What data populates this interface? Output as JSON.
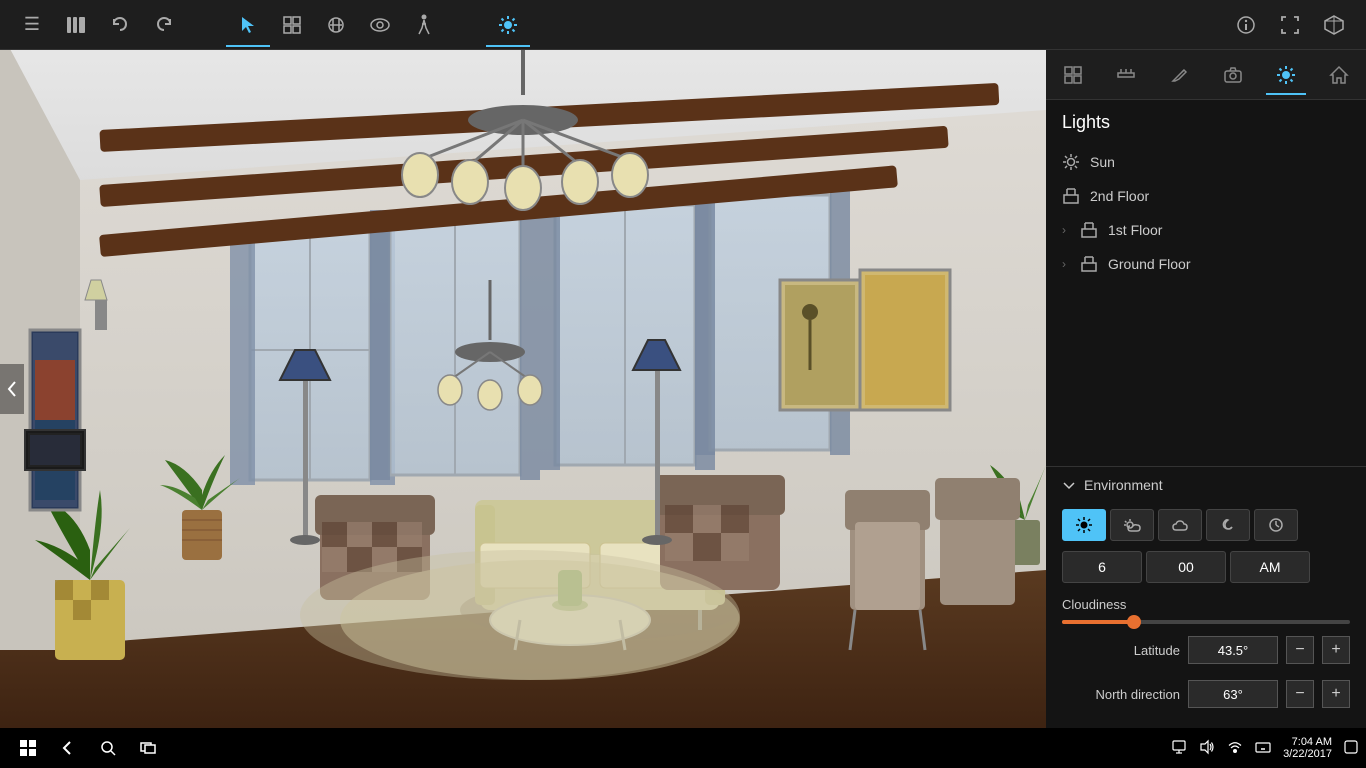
{
  "toolbar": {
    "icons": [
      {
        "name": "menu-icon",
        "symbol": "☰",
        "active": false
      },
      {
        "name": "library-icon",
        "symbol": "📚",
        "active": false
      },
      {
        "name": "undo-icon",
        "symbol": "↩",
        "active": false
      },
      {
        "name": "redo-icon",
        "symbol": "↪",
        "active": false
      },
      {
        "name": "select-icon",
        "symbol": "⬆",
        "active": true
      },
      {
        "name": "transform-icon",
        "symbol": "⊞",
        "active": false
      },
      {
        "name": "edit-icon",
        "symbol": "✂",
        "active": false
      },
      {
        "name": "view-icon",
        "symbol": "👁",
        "active": false
      },
      {
        "name": "walk-icon",
        "symbol": "🚶",
        "active": false
      },
      {
        "name": "sun-icon",
        "symbol": "☀",
        "active": true
      },
      {
        "name": "info-icon",
        "symbol": "ℹ",
        "active": false
      },
      {
        "name": "fullscreen-icon",
        "symbol": "⛶",
        "active": false
      },
      {
        "name": "cube-icon",
        "symbol": "⬡",
        "active": false
      }
    ]
  },
  "right_panel": {
    "tools": [
      {
        "name": "arrange-tool",
        "symbol": "🔧",
        "active": false
      },
      {
        "name": "measure-tool",
        "symbol": "📐",
        "active": false
      },
      {
        "name": "draw-tool",
        "symbol": "✏",
        "active": false
      },
      {
        "name": "camera-tool",
        "symbol": "📷",
        "active": false
      },
      {
        "name": "light-tool",
        "symbol": "☀",
        "active": true
      },
      {
        "name": "home-tool",
        "symbol": "🏠",
        "active": false
      }
    ],
    "lights_title": "Lights",
    "lights_items": [
      {
        "label": "Sun",
        "icon": "sun",
        "indent": false
      },
      {
        "label": "2nd Floor",
        "icon": "floor",
        "indent": false
      },
      {
        "label": "1st Floor",
        "icon": "floor",
        "indent": false,
        "chevron": true
      },
      {
        "label": "Ground Floor",
        "icon": "floor",
        "indent": false,
        "chevron": true
      }
    ],
    "environment": {
      "title": "Environment",
      "time_buttons": [
        {
          "label": "☀",
          "active": true
        },
        {
          "label": "⛅",
          "active": false
        },
        {
          "label": "☁",
          "active": false
        },
        {
          "label": "🌙",
          "active": false
        },
        {
          "label": "🕐",
          "active": false
        }
      ],
      "time_hour": "6",
      "time_minute": "00",
      "time_ampm": "AM",
      "cloudiness_label": "Cloudiness",
      "cloudiness_value": 25,
      "latitude_label": "Latitude",
      "latitude_value": "43.5°",
      "north_direction_label": "North direction",
      "north_direction_value": "63°"
    }
  },
  "taskbar": {
    "time": "7:04 AM",
    "date": "3/22/2017"
  },
  "viewport": {
    "left_arrow": "❯"
  }
}
